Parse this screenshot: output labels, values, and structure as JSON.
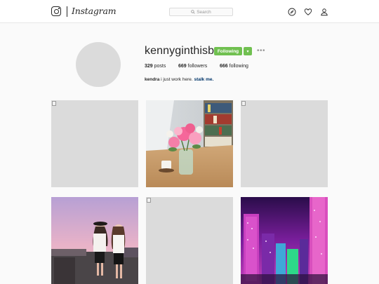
{
  "header": {
    "brand": "Instagram",
    "search_placeholder": "Search"
  },
  "profile": {
    "username": "kennyginthisb",
    "follow_button": "Following",
    "dropdown_glyph": "▾",
    "more_glyph": "•••",
    "stats": {
      "posts_count": "329",
      "posts_label": "posts",
      "followers_count": "669",
      "followers_label": "followers",
      "following_count": "666",
      "following_label": "following"
    },
    "bio": {
      "name": "kendra",
      "text": "i just work here.",
      "link": "stalk me."
    }
  },
  "colors": {
    "follow_green": "#70c050",
    "link_blue": "#003569",
    "placeholder_gray": "#dbdbdb"
  },
  "icons": [
    "instagram-logo-icon",
    "search-icon",
    "explore-compass-icon",
    "heart-icon",
    "profile-icon"
  ],
  "grid": [
    {
      "kind": "broken-image"
    },
    {
      "kind": "photo",
      "subject": "flowers"
    },
    {
      "kind": "broken-image"
    },
    {
      "kind": "photo",
      "subject": "rooftop-friends"
    },
    {
      "kind": "broken-image"
    },
    {
      "kind": "photo",
      "subject": "city-night"
    }
  ]
}
